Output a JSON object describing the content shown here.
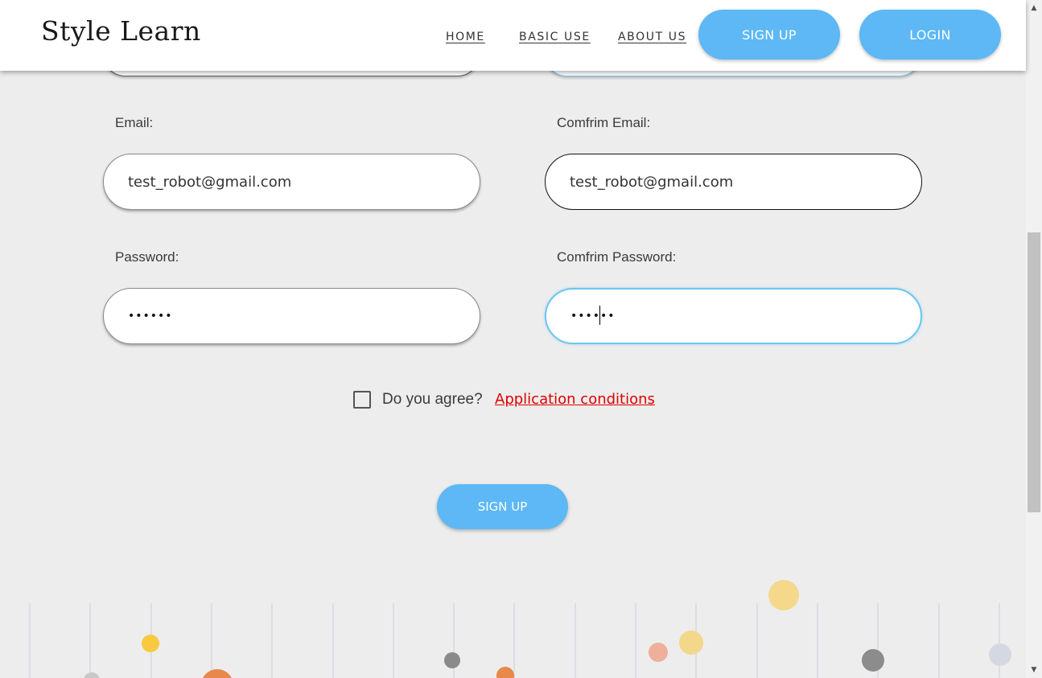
{
  "header": {
    "logo": "Style Learn",
    "nav": {
      "home": "HOME",
      "basic_use": "BASIC USE",
      "about_us": "ABOUT US"
    },
    "signup_label": "SIGN UP",
    "login_label": "LOGIN"
  },
  "form": {
    "email": {
      "label": "Email:",
      "value": "test_robot@gmail.com"
    },
    "confirm_email": {
      "label": "Comfrim Email:",
      "value": "test_robot@gmail.com"
    },
    "password": {
      "label": "Password:",
      "value": "••••••"
    },
    "confirm_password": {
      "label": "Comfrim Password:",
      "value": "••••••"
    },
    "agree_label": "Do you agree?",
    "agree_checked": false,
    "conditions_link": "Application conditions",
    "submit_label": "SIGN UP"
  },
  "colors": {
    "accent": "#5db8f5",
    "link": "#e00000",
    "background": "#ededed"
  },
  "scrollbar": {
    "position_fraction": 0.58
  },
  "icons": {
    "scroll_up": "triangle-up-icon",
    "scroll_down": "triangle-down-icon",
    "checkbox": "checkbox-unchecked-icon"
  }
}
